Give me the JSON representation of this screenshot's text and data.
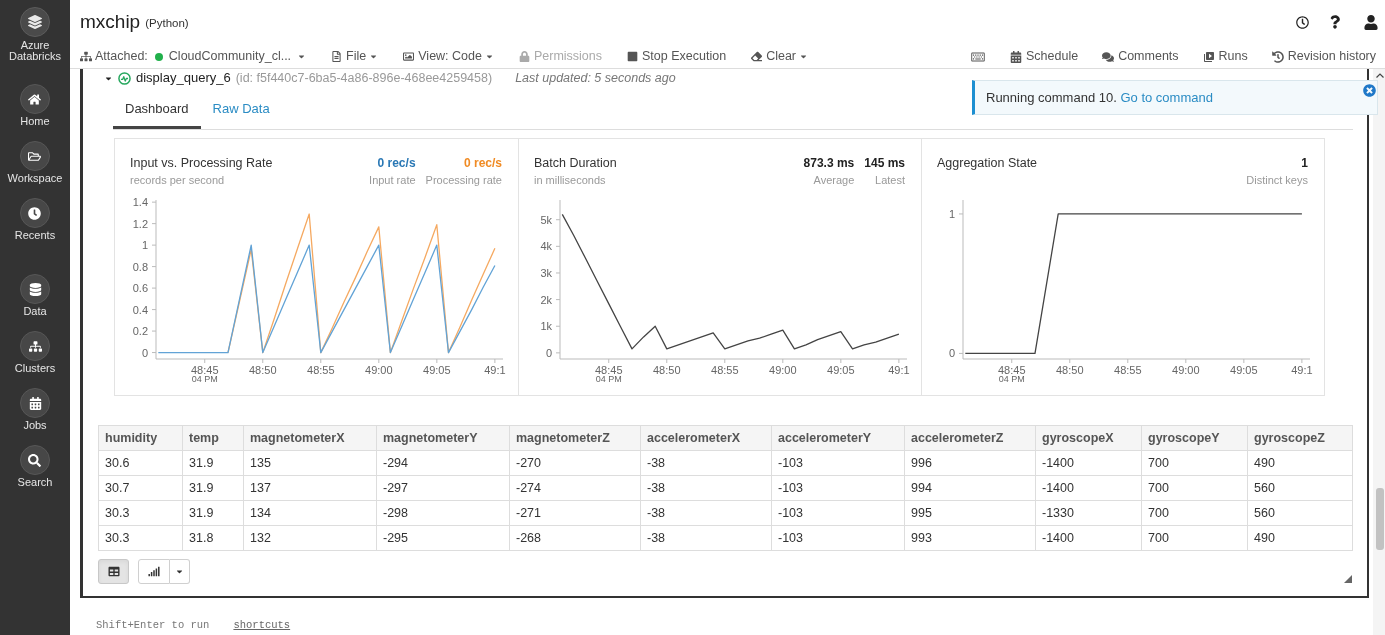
{
  "header": {
    "title": "mxchip",
    "language": "(Python)"
  },
  "sidebar": {
    "logo": "Azure Databricks",
    "groups": [
      {
        "items": [
          {
            "label": "Home"
          },
          {
            "label": "Workspace"
          },
          {
            "label": "Recents"
          }
        ]
      },
      {
        "items": [
          {
            "label": "Data"
          },
          {
            "label": "Clusters"
          },
          {
            "label": "Jobs"
          },
          {
            "label": "Search"
          }
        ]
      }
    ]
  },
  "toolbar": {
    "attached": {
      "label": "Attached:",
      "cluster": "CloudCommunity_cl..."
    },
    "menus": [
      {
        "label": "File",
        "dropdown": true,
        "disabled": false
      },
      {
        "label": "View: Code",
        "dropdown": true,
        "disabled": false
      },
      {
        "label": "Permissions",
        "dropdown": false,
        "disabled": true
      },
      {
        "label": "Stop Execution",
        "dropdown": false,
        "disabled": false
      },
      {
        "label": "Clear",
        "dropdown": true,
        "disabled": false
      }
    ],
    "right": [
      {
        "label": "Schedule"
      },
      {
        "label": "Comments"
      },
      {
        "label": "Runs"
      },
      {
        "label": "Revision history"
      }
    ]
  },
  "notification": {
    "text": "Running command 10.",
    "link": "Go to command"
  },
  "query": {
    "expanded": true,
    "name": "display_query_6",
    "id": "(id: f5f440c7-6ba5-4a86-896e-468ee4259458)",
    "updated": "Last updated: 5 seconds ago"
  },
  "tabs": [
    {
      "label": "Dashboard",
      "selected": true
    },
    {
      "label": "Raw Data",
      "selected": false
    }
  ],
  "panels": [
    {
      "subtitle": "records per second",
      "stats": [
        {
          "value": "0 rec/s",
          "label": "Input rate",
          "color": "#2a78b5"
        },
        {
          "value": "0 rec/s",
          "label": "Processing rate",
          "color": "#f08b24"
        }
      ],
      "chart_data": {
        "type": "line",
        "title": "Input vs. Processing Rate",
        "categories": [
          null,
          null,
          null,
          null,
          "48:45",
          null,
          null,
          null,
          null,
          "48:50",
          null,
          null,
          null,
          null,
          "48:55",
          null,
          null,
          null,
          null,
          "49:00",
          null,
          null,
          null,
          null,
          "49:05",
          null,
          null,
          null,
          null,
          "49:1"
        ],
        "series": [
          {
            "color": "#62a3d6",
            "values": [
              0,
              0,
              0,
              0,
              0,
              0,
              0,
              0.5,
              1,
              0,
              0.25,
              0.5,
              0.75,
              1,
              0,
              0.2,
              0.4,
              0.6,
              0.8,
              1,
              0,
              0.25,
              0.5,
              0.75,
              1,
              0,
              0.2,
              0.4,
              0.61,
              0.81
            ]
          },
          {
            "color": "#f5a961",
            "values": [
              null,
              null,
              null,
              null,
              null,
              null,
              0,
              0.48,
              0.96,
              0,
              0.32,
              0.65,
              0.97,
              1.29,
              0,
              0.23,
              0.47,
              0.7,
              0.94,
              1.17,
              0,
              0.3,
              0.6,
              0.89,
              1.19,
              0,
              0.24,
              0.49,
              0.73,
              0.97
            ]
          }
        ],
        "ylim": [
          -0.06,
          1.42
        ],
        "yticks": [
          0,
          0.2,
          0.4,
          0.6,
          0.8,
          1,
          1.2,
          1.4
        ],
        "annotations": [
          "04 PM"
        ]
      }
    },
    {
      "subtitle": "in milliseconds",
      "stats": [
        {
          "value": "873.3 ms",
          "label": "Average",
          "color": "#222222"
        },
        {
          "value": "145 ms",
          "label": "Latest",
          "color": "#222222"
        }
      ],
      "chart_data": {
        "type": "line",
        "title": "Batch Duration",
        "categories": [
          null,
          null,
          null,
          null,
          "48:45",
          null,
          null,
          null,
          null,
          "48:50",
          null,
          null,
          null,
          null,
          "48:55",
          null,
          null,
          null,
          null,
          "49:00",
          null,
          null,
          null,
          null,
          "49:05",
          null,
          null,
          null,
          null,
          "49:1"
        ],
        "series": [
          {
            "color": "#444444",
            "values": [
              5200,
              4400,
              3550,
              2700,
              1850,
              1000,
              150,
              600,
              1000,
              150,
              300,
              450,
              600,
              750,
              150,
              300,
              450,
              550,
              700,
              850,
              150,
              300,
              500,
              650,
              800,
              150,
              300,
              400,
              550,
              700
            ]
          }
        ],
        "ylim": [
          -230,
          5740
        ],
        "yticks": [
          {
            "value": 0,
            "label": "0"
          },
          {
            "value": 1000,
            "label": "1k"
          },
          {
            "value": 2000,
            "label": "2k"
          },
          {
            "value": 3000,
            "label": "3k"
          },
          {
            "value": 4000,
            "label": "4k"
          },
          {
            "value": 5000,
            "label": "5k"
          }
        ],
        "annotations": [
          "04 PM"
        ]
      }
    },
    {
      "stats": [
        {
          "value": "1",
          "label": "Distinct keys",
          "color": "#222222"
        }
      ],
      "chart_data": {
        "type": "line",
        "title": "Aggregation State",
        "categories": [
          null,
          null,
          null,
          null,
          "48:45",
          null,
          null,
          null,
          null,
          "48:50",
          null,
          null,
          null,
          null,
          "48:55",
          null,
          null,
          null,
          null,
          "49:00",
          null,
          null,
          null,
          null,
          "49:05",
          null,
          null,
          null,
          null,
          "49:1"
        ],
        "series": [
          {
            "color": "#444444",
            "values": [
              0,
              0,
              0,
              0,
              0,
              0,
              0,
              0.5,
              1,
              1,
              1,
              1,
              1,
              1,
              1,
              1,
              1,
              1,
              1,
              1,
              1,
              1,
              1,
              1,
              1,
              1,
              1,
              1,
              1,
              1
            ]
          }
        ],
        "ylim": [
          -0.04,
          1.1
        ],
        "yticks": [
          0,
          1
        ],
        "annotations": [
          "04 PM"
        ]
      }
    }
  ],
  "table": {
    "columns": [
      "humidity",
      "temp",
      "magnetometerX",
      "magnetometerY",
      "magnetometerZ",
      "accelerometerX",
      "accelerometerY",
      "accelerometerZ",
      "gyroscopeX",
      "gyroscopeY",
      "gyroscopeZ"
    ],
    "rows": [
      [
        "30.6",
        "31.9",
        "135",
        "-294",
        "-270",
        "-38",
        "-103",
        "996",
        "-1400",
        "700",
        "490"
      ],
      [
        "30.7",
        "31.9",
        "137",
        "-297",
        "-274",
        "-38",
        "-103",
        "994",
        "-1400",
        "700",
        "560"
      ],
      [
        "30.3",
        "31.9",
        "134",
        "-298",
        "-271",
        "-38",
        "-103",
        "995",
        "-1330",
        "700",
        "560"
      ],
      [
        "30.3",
        "31.8",
        "132",
        "-295",
        "-268",
        "-38",
        "-103",
        "993",
        "-1400",
        "700",
        "490"
      ]
    ]
  },
  "view_buttons": [
    {
      "kind": "table",
      "selected": true
    },
    {
      "kind": "chart",
      "selected": false
    }
  ],
  "footer": {
    "hint": "Shift+Enter to run",
    "link": "shortcuts"
  }
}
